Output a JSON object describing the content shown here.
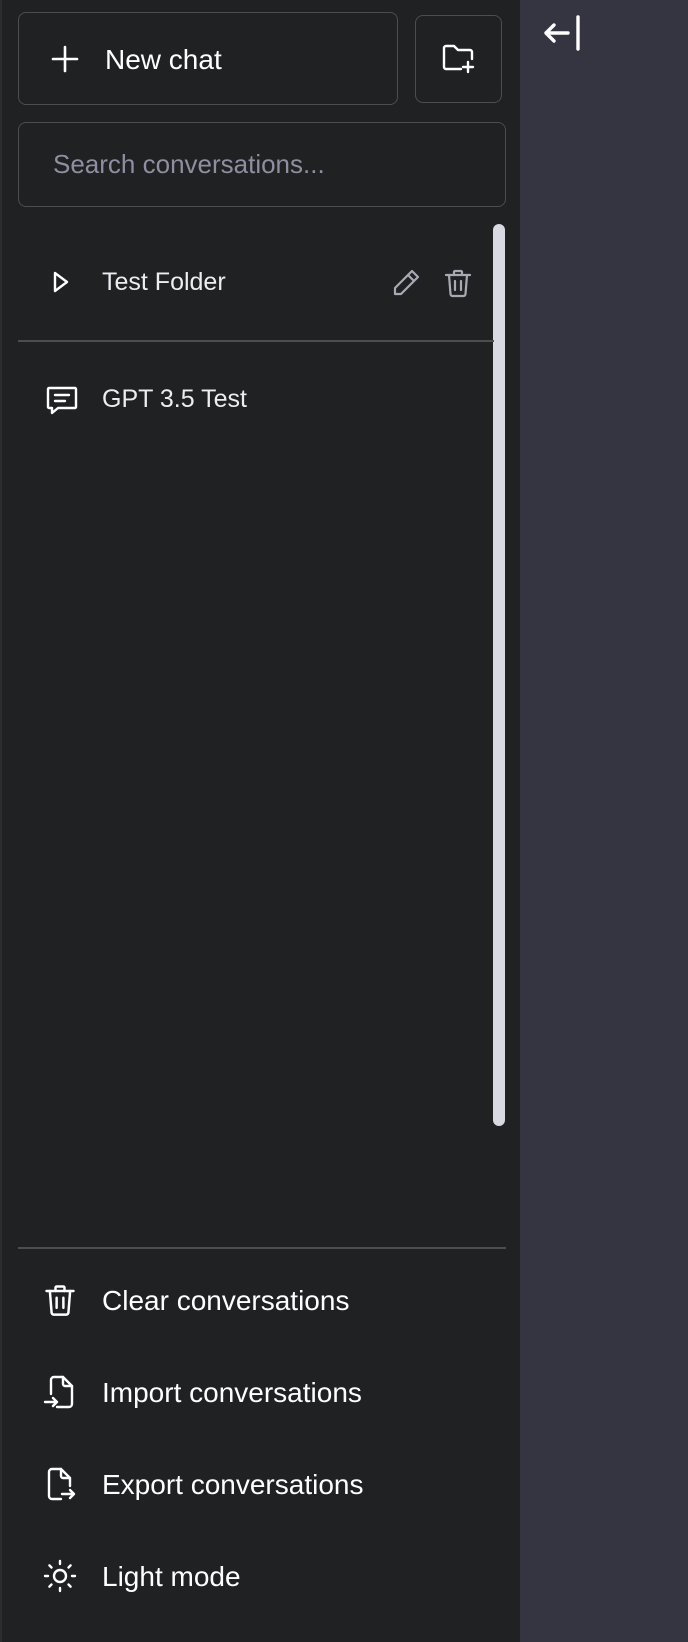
{
  "sidebar": {
    "new_chat_label": "New chat",
    "search_placeholder": "Search conversations...",
    "folders": [
      {
        "label": "Test Folder"
      }
    ],
    "conversations": [
      {
        "label": "GPT 3.5 Test"
      }
    ],
    "footer": {
      "clear_label": "Clear conversations",
      "import_label": "Import conversations",
      "export_label": "Export conversations",
      "theme_label": "Light mode"
    }
  },
  "icons": {
    "new_chat": "plus-icon",
    "new_folder": "folder-plus-icon",
    "folder_caret": "caret-right-icon",
    "edit": "pencil-icon",
    "delete": "trash-icon",
    "conversation": "message-icon",
    "clear": "trash-icon",
    "import": "file-import-icon",
    "export": "file-export-icon",
    "theme": "sun-icon",
    "collapse": "arrow-bar-left-icon"
  },
  "colors": {
    "sidebar_bg": "#202123",
    "main_bg": "#343541",
    "border": "#4d4d4f",
    "placeholder": "#8e8ea0"
  }
}
